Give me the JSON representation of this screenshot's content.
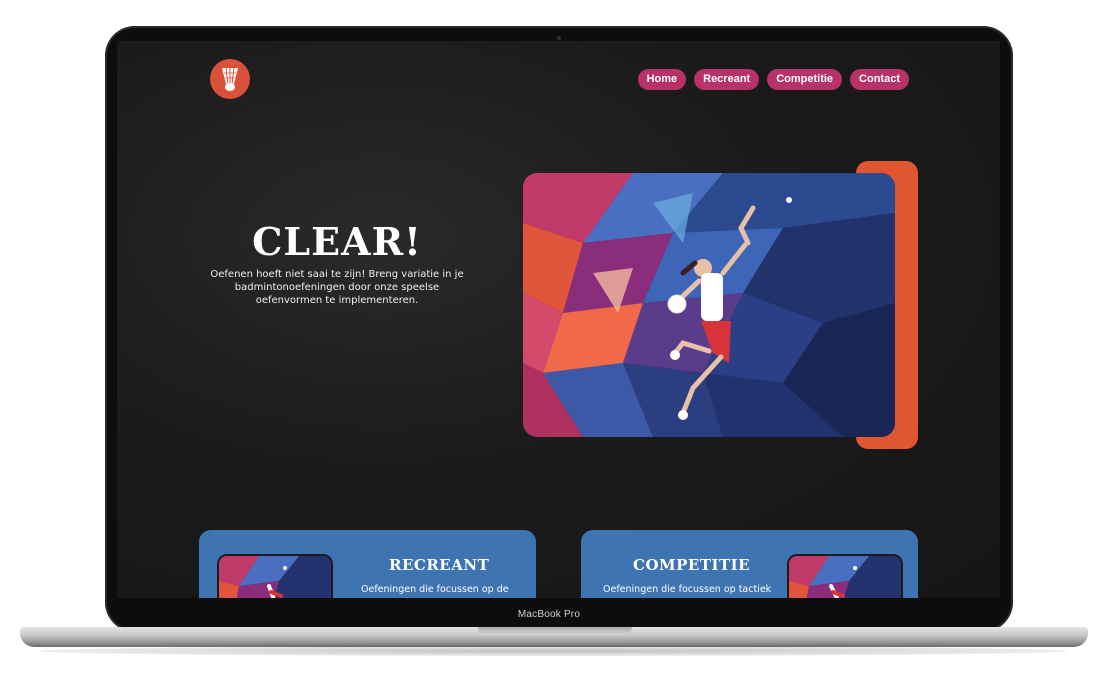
{
  "device": {
    "model_label": "MacBook Pro"
  },
  "header": {
    "logo_icon": "shuttlecock-icon",
    "nav": [
      {
        "label": "Home"
      },
      {
        "label": "Recreant"
      },
      {
        "label": "Competitie"
      },
      {
        "label": "Contact"
      }
    ]
  },
  "hero": {
    "title": "CLEAR!",
    "text": "Oefenen hoeft niet saai te zijn! Breng variatie in je badmintonoefeningen door onze speelse oefenvormen te implementeren.",
    "image_icon": "badminton-player-illustration"
  },
  "cards": [
    {
      "title": "RECREANT",
      "text": "Oefeningen die focussen op de"
    },
    {
      "title": "COMPETITIE",
      "text": "Oefeningen die focussen op tactiek"
    }
  ],
  "colors": {
    "nav_button": "#b8326a",
    "logo": "#d9513b",
    "accent": "#e05630",
    "card": "#3f74b3",
    "background": "#1b1b1b"
  }
}
